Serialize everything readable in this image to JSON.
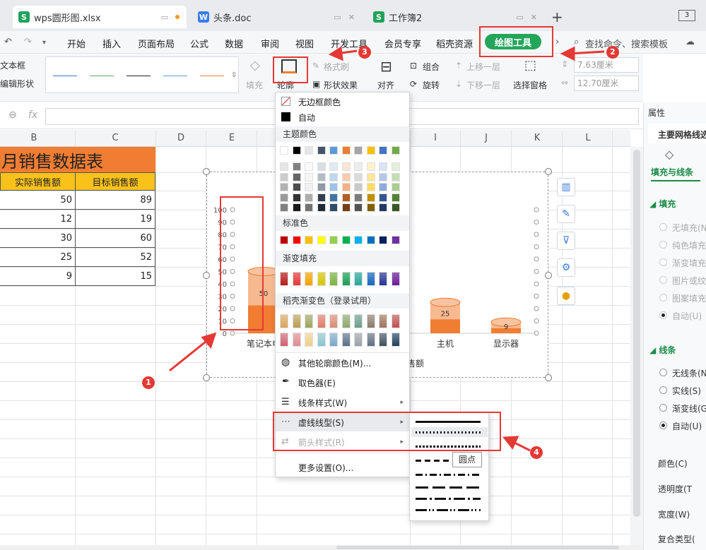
{
  "tabs": [
    {
      "label": "wps圆形图.xlsx",
      "icon": "S"
    },
    {
      "label": "头条.doc",
      "icon": "W"
    },
    {
      "label": "工作簿2",
      "icon": "S"
    }
  ],
  "tab_counter": "3",
  "menu": [
    "开始",
    "插入",
    "页面布局",
    "公式",
    "数据",
    "审阅",
    "视图",
    "开发工具",
    "会员专享",
    "稻壳资源"
  ],
  "active_tab": "绘图工具",
  "search_text": "查找命令、搜索模板",
  "ribbon": {
    "text_box": "文本框",
    "edit_shape": "编辑形状",
    "fill": "填充",
    "outline": "轮廓",
    "format_painter": "格式刷",
    "shape_effects": "形状效果",
    "align": "对齐",
    "group": "组合",
    "rotate": "旋转",
    "bring_forward": "上移一层",
    "send_backward": "下移一层",
    "selection_pane": "选择窗格",
    "height": "7.63厘米",
    "width": "12.70厘米",
    "line_colors": [
      "#3a7bd5",
      "#5aa55a",
      "#222222",
      "#5b9bd5",
      "#f07d32"
    ]
  },
  "formula": {
    "name_box": "",
    "fx": "fx"
  },
  "columns": [
    "B",
    "C",
    "D",
    "E",
    "F",
    "G",
    "H",
    "I",
    "J",
    "K",
    "L"
  ],
  "sheet": {
    "title": "月销售数据表",
    "headers": [
      "实际销售额",
      "目标销售额"
    ],
    "rows": [
      {
        "actual": "50",
        "target": "89"
      },
      {
        "actual": "12",
        "target": "19"
      },
      {
        "actual": "30",
        "target": "60"
      },
      {
        "actual": "25",
        "target": "52"
      },
      {
        "actual": "9",
        "target": "15"
      }
    ]
  },
  "chart_data": {
    "type": "bar",
    "categories": [
      "笔记本电",
      "主机",
      "显示器"
    ],
    "values": [
      50,
      25,
      9
    ],
    "ylim": [
      0,
      100
    ],
    "yticks": [
      "100",
      "90",
      "80",
      "70",
      "60",
      "50",
      "40",
      "30",
      "20",
      "10",
      "0"
    ],
    "footer": "售额",
    "bar_color": "#f07d32",
    "bar_light": "#f8c3a1"
  },
  "dropdown": {
    "no_border": "无边框颜色",
    "auto": "自动",
    "theme_colors": "主题颜色",
    "standard_colors": "标准色",
    "gradient_fill": "渐变填充",
    "docer_gradient": "稻壳渐变色（登录试用）",
    "more_colors": "其他轮廓颜色(M)...",
    "eyedropper": "取色器(E)",
    "line_style": "线条样式(W)",
    "dash_type": "虚线线型(S)",
    "arrow_style": "箭头样式(R)",
    "more_settings": "更多设置(O)...",
    "theme_row": [
      "#ffffff",
      "#000000",
      "#e7e6e6",
      "#44546a",
      "#5b9bd5",
      "#ed7d31",
      "#a5a5a5",
      "#ffc000",
      "#4472c4",
      "#70ad47"
    ],
    "standard_row": [
      "#c00000",
      "#ff0000",
      "#ffc000",
      "#ffff00",
      "#92d050",
      "#00b050",
      "#00b0f0",
      "#0070c0",
      "#002060",
      "#7030a0"
    ],
    "gradient_row": [
      "#b71c1c",
      "#e53935",
      "#f4a300",
      "#d4c600",
      "#7cb342",
      "#1b9e52",
      "#26a69a",
      "#1565c0",
      "#283593",
      "#6a1b9a"
    ],
    "docer_row1": [
      "#d9a45b",
      "#b89f52",
      "#9ea45a",
      "#e07a6b",
      "#d98a74",
      "#8aa86c",
      "#6a9c8a",
      "#8c7a6b",
      "#a0745b",
      "#c05050"
    ],
    "docer_row2": [
      "#d06070",
      "#e08a90",
      "#eecf8a",
      "#8ac4d0",
      "#7aa8c8",
      "#5a7088",
      "#9aa0a8",
      "#607080",
      "#405060",
      "#204060"
    ]
  },
  "submenu": {
    "tooltip": "圆点"
  },
  "right_panel": {
    "title": "属性",
    "subtitle": "主要网格线选",
    "fill_line": "填充与线条",
    "fill": "填充",
    "fill_options": [
      "无填充(N",
      "纯色填充",
      "渐变填充",
      "图片或纹",
      "图案填充",
      "自动(U)"
    ],
    "line": "线条",
    "line_options": [
      "无线条(N",
      "实线(S)",
      "渐变线(G",
      "自动(U)"
    ],
    "color": "颜色(C)",
    "transparency": "透明度(T",
    "width": "宽度(W)",
    "compound": "复合类型("
  },
  "annotations": [
    "1",
    "2",
    "3",
    "4"
  ]
}
